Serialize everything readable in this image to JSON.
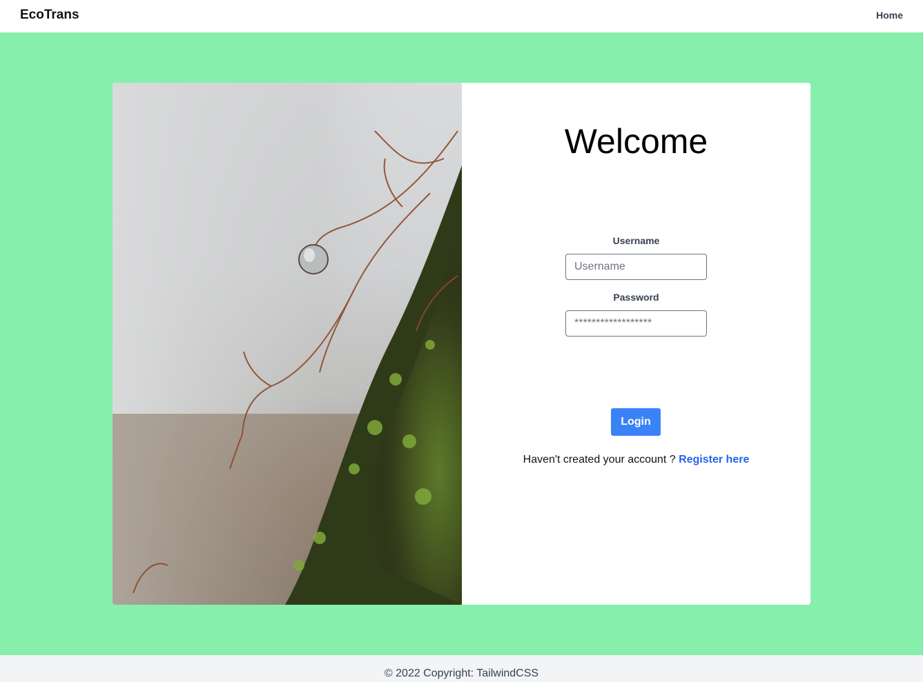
{
  "navbar": {
    "brand": "EcoTrans",
    "home_link": "Home"
  },
  "form": {
    "title": "Welcome",
    "username_label": "Username",
    "username_placeholder": "Username",
    "password_label": "Password",
    "password_placeholder": "******************",
    "login_button": "Login",
    "register_prompt": "Haven't created your account ?",
    "register_link": "Register here"
  },
  "footer": {
    "copyright": "© 2022 Copyright: TailwindCSS"
  },
  "colors": {
    "page_background": "#86efac",
    "accent": "#3b82f6",
    "link": "#2563eb"
  }
}
